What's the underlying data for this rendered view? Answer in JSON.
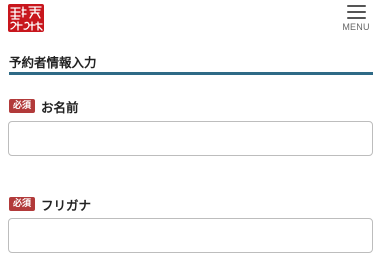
{
  "header": {
    "logo_name": "logo",
    "menu_label": "MENU",
    "icons": {
      "menu": "hamburger-icon"
    }
  },
  "section": {
    "title": "予約者情報入力"
  },
  "fields": [
    {
      "badge": "必須",
      "label": "お名前",
      "value": "",
      "placeholder": ""
    },
    {
      "badge": "必須",
      "label": "フリガナ",
      "value": "",
      "placeholder": ""
    }
  ],
  "colors": {
    "logo_red": "#c8161d",
    "badge_red": "#b23a3a",
    "rule_blue": "#2f6a86",
    "input_border": "#bdbdbd"
  }
}
